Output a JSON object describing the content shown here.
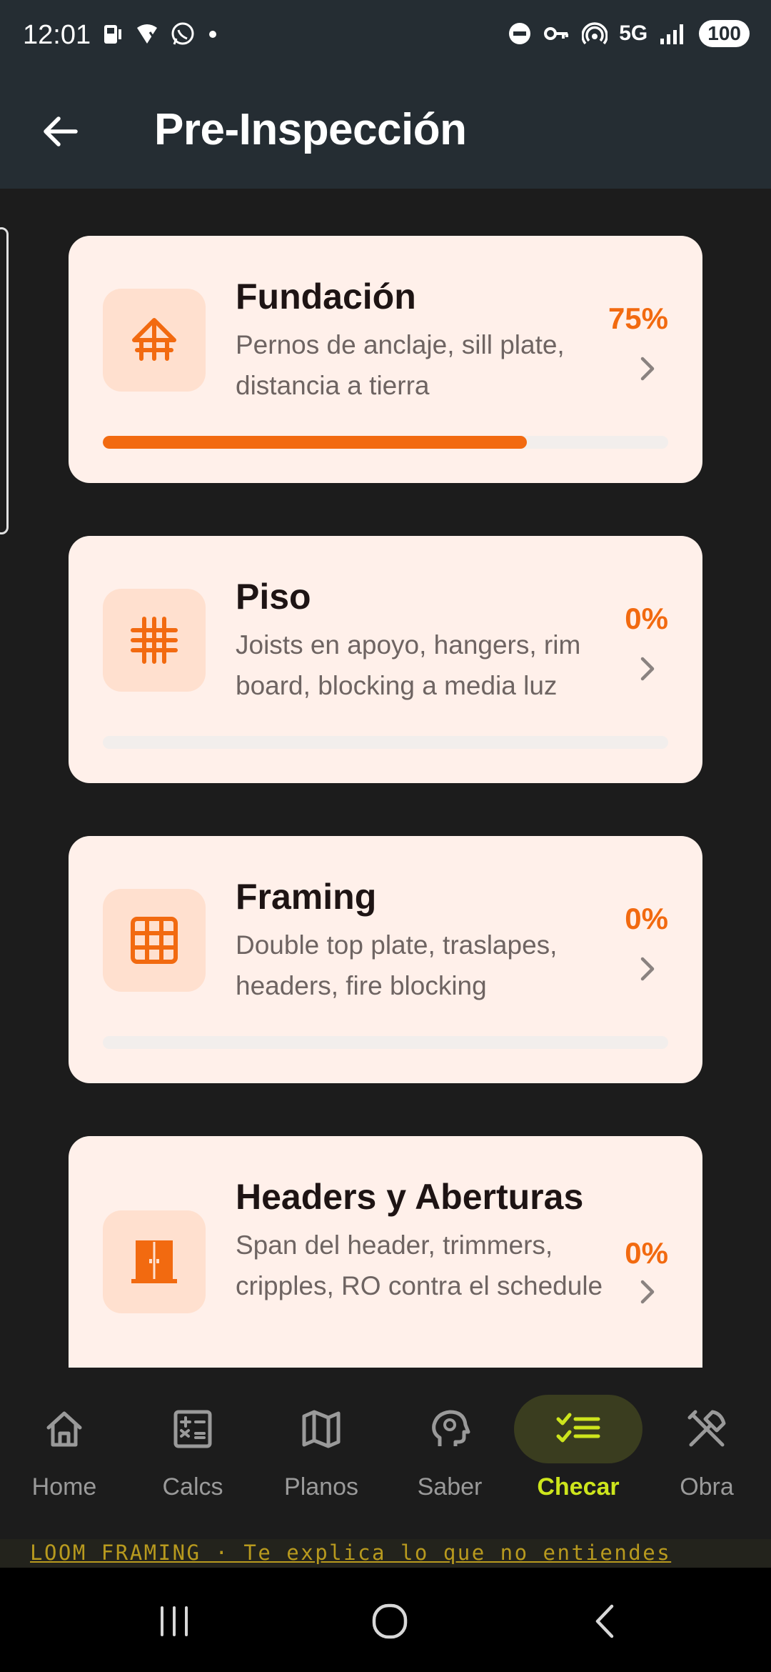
{
  "status_bar": {
    "time": "12:01",
    "network": "5G",
    "battery": "100",
    "left_icons": [
      "sim-icon",
      "wifi-calling-icon",
      "whatsapp-icon",
      "dot-icon"
    ],
    "right_icons": [
      "dnd-icon",
      "vpn-key-icon",
      "hotspot-icon",
      "signal-icon"
    ]
  },
  "app_bar": {
    "title": "Pre-Inspección",
    "back_icon": "arrow-left-icon"
  },
  "cards": [
    {
      "title": "Fundación",
      "description": "Pernos de anclaje, sill plate, distancia a tierra",
      "percent_label": "75%",
      "progress": 0.75,
      "icon": "foundation-icon"
    },
    {
      "title": "Piso",
      "description": "Joists en apoyo, hangers, rim board, blocking a media luz",
      "percent_label": "0%",
      "progress": 0,
      "icon": "floor-grid-icon"
    },
    {
      "title": "Framing",
      "description": "Double top plate, traslapes, headers, fire blocking",
      "percent_label": "0%",
      "progress": 0,
      "icon": "framing-grid-icon"
    },
    {
      "title": "Headers y Aberturas",
      "description": "Span del header, trimmers, cripples, RO contra el schedule",
      "percent_label": "0%",
      "progress": 0,
      "icon": "door-icon"
    }
  ],
  "bottom_nav": {
    "items": [
      {
        "label": "Home",
        "icon": "home-icon"
      },
      {
        "label": "Calcs",
        "icon": "calculator-icon"
      },
      {
        "label": "Planos",
        "icon": "map-icon"
      },
      {
        "label": "Saber",
        "icon": "brain-icon"
      },
      {
        "label": "Checar",
        "icon": "checklist-icon",
        "active": true
      },
      {
        "label": "Obra",
        "icon": "tools-icon"
      }
    ]
  },
  "marquee": {
    "text": "LOOM FRAMING  ·  Te explica lo que no entiendes"
  },
  "colors": {
    "accent": "#f26a10",
    "active_nav": "#cde51c",
    "card_bg": "#fff0ea",
    "app_bar_bg": "#252d33"
  }
}
